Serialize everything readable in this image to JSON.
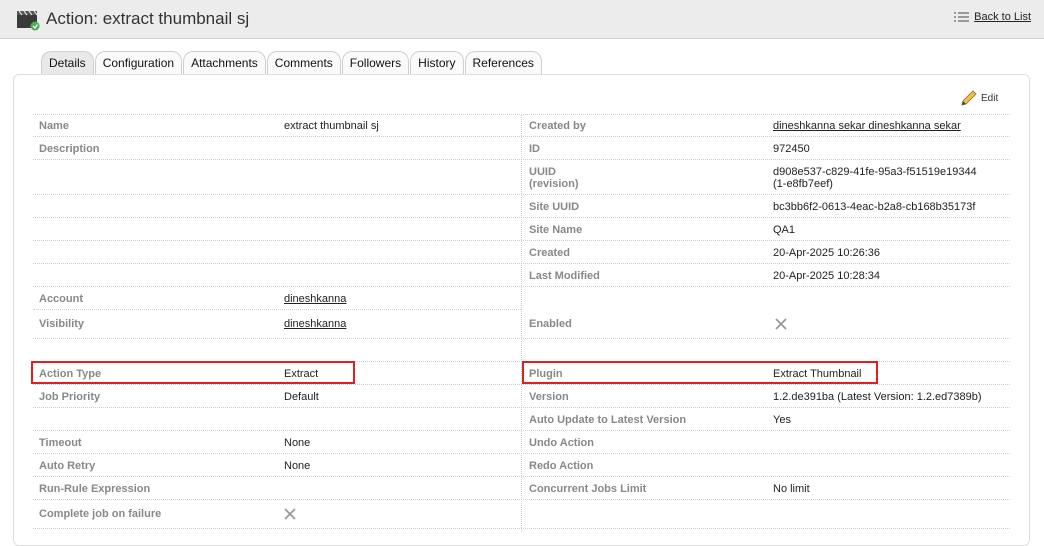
{
  "header": {
    "title": "Action: extract thumbnail sj",
    "back_label": "Back to List",
    "icon": "clapperboard-icon"
  },
  "tabs": [
    {
      "label": "Details",
      "active": true
    },
    {
      "label": "Configuration"
    },
    {
      "label": "Attachments"
    },
    {
      "label": "Comments"
    },
    {
      "label": "Followers"
    },
    {
      "label": "History"
    },
    {
      "label": "References"
    }
  ],
  "edit_label": "Edit",
  "left": {
    "name_label": "Name",
    "name_value": "extract thumbnail sj",
    "description_label": "Description",
    "account_label": "Account",
    "account_value": "dineshkanna",
    "visibility_label": "Visibility",
    "visibility_value": "dineshkanna",
    "action_type_label": "Action Type",
    "action_type_value": "Extract",
    "job_priority_label": "Job Priority",
    "job_priority_value": "Default",
    "timeout_label": "Timeout",
    "timeout_value": "None",
    "auto_retry_label": "Auto Retry",
    "auto_retry_value": "None",
    "run_rule_label": "Run-Rule Expression",
    "complete_job_label": "Complete job on failure"
  },
  "right": {
    "created_by_label": "Created by",
    "created_by_value": "dineshkanna sekar dineshkanna sekar",
    "id_label": "ID",
    "id_value": "972450",
    "uuid_label_1": "UUID",
    "uuid_label_2": "(revision)",
    "uuid_value_1": "d908e537-c829-41fe-95a3-f51519e19344",
    "uuid_value_2": "(1-e8fb7eef)",
    "site_uuid_label": "Site UUID",
    "site_uuid_value": "bc3bb6f2-0613-4eac-b2a8-cb168b35173f",
    "site_name_label": "Site Name",
    "site_name_value": "QA1",
    "created_label": "Created",
    "created_value": "20-Apr-2025 10:26:36",
    "last_modified_label": "Last Modified",
    "last_modified_value": "20-Apr-2025 10:28:34",
    "enabled_label": "Enabled",
    "plugin_label": "Plugin",
    "plugin_value": "Extract Thumbnail",
    "version_label": "Version",
    "version_value": "1.2.de391ba (Latest Version: 1.2.ed7389b)",
    "auto_update_label": "Auto Update to Latest Version",
    "auto_update_value": "Yes",
    "undo_label": "Undo Action",
    "redo_label": "Redo Action",
    "concurrent_label": "Concurrent Jobs Limit",
    "concurrent_value": "No limit"
  },
  "colors": {
    "highlight": "#e02020",
    "label": "#888888"
  }
}
